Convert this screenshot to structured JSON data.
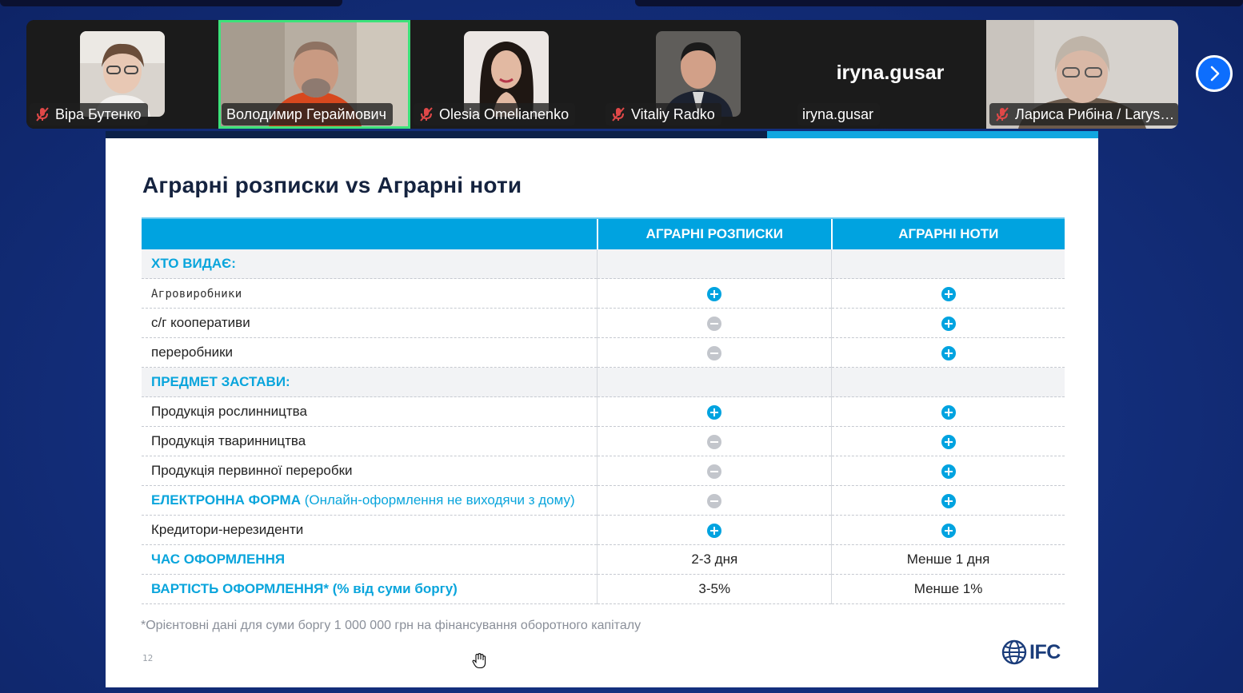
{
  "participants": [
    {
      "name": "Віра Бутенко",
      "muted": true
    },
    {
      "name": "Володимир Гераймович",
      "muted": false,
      "active_speaker": true
    },
    {
      "name": "Olesia Omelianenko",
      "muted": true
    },
    {
      "name": "Vitaliy Radko",
      "muted": true
    },
    {
      "name": "iryna.gusar",
      "muted": false,
      "display_text": "iryna.gusar"
    },
    {
      "name": "Лариса Рибіна / Larys…",
      "muted": true
    }
  ],
  "slide": {
    "title": "Аграрні розписки vs Аграрні ноти",
    "columns": [
      "",
      "АГРАРНІ РОЗПИСКИ",
      "АГРАРНІ НОТИ"
    ],
    "rows": [
      {
        "label": "ХТО ВИДАЄ:",
        "type": "section"
      },
      {
        "label": "Агровиробники",
        "type": "item-mono",
        "a": "+",
        "b": "+"
      },
      {
        "label": "с/г кооперативи",
        "type": "item",
        "a": "-",
        "b": "+"
      },
      {
        "label": "переробники",
        "type": "item",
        "a": "-",
        "b": "+"
      },
      {
        "label": "ПРЕДМЕТ ЗАСТАВИ:",
        "type": "section"
      },
      {
        "label": "Продукція рослинництва",
        "type": "item",
        "a": "+",
        "b": "+"
      },
      {
        "label": "Продукція тваринництва",
        "type": "item",
        "a": "-",
        "b": "+"
      },
      {
        "label": "Продукція первинної переробки",
        "type": "item",
        "a": "-",
        "b": "+"
      },
      {
        "label": "ЕЛЕКТРОННА ФОРМА",
        "note": "(Онлайн-оформлення не виходячи з дому)",
        "type": "highlight",
        "a": "-",
        "b": "+"
      },
      {
        "label": "Кредитори-нерезиденти",
        "type": "item",
        "a": "+",
        "b": "+"
      },
      {
        "label": "ЧАС ОФОРМЛЕННЯ",
        "type": "highlight",
        "a_text": "2-3 дня",
        "b_text": "Менше 1 дня"
      },
      {
        "label": "ВАРТІСТЬ ОФОРМЛЕННЯ* (% від суми боргу)",
        "type": "highlight",
        "a_text": "3-5%",
        "b_text": "Менше 1%"
      }
    ],
    "footnote": "*Орієнтовні дані для суми боргу 1 000 000 грн на фінансування оборотного капіталу",
    "page_number": "12",
    "logo_text": "IFC"
  },
  "colors": {
    "accent": "#00a3e0",
    "title": "#15233f",
    "active_speaker_border": "#3de27a",
    "nav_button": "#0d6efd"
  },
  "icons": [
    "muted-mic-icon",
    "chevron-right-icon",
    "plus-circle-icon",
    "minus-circle-icon",
    "ifc-globe-icon",
    "hand-cursor-icon"
  ]
}
